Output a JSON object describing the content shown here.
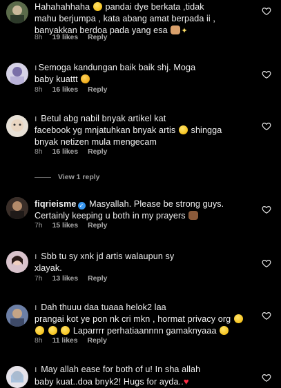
{
  "comments": [
    {
      "lines": [
        "Hahahahhaha",
        "pandai dye berkata ,tidak",
        "mahu berjumpa , kata abang amat berpada ii ,",
        "banyakkan berdoa pada yang esa"
      ],
      "time": "8h",
      "likes": "19 likes",
      "reply": "Reply"
    },
    {
      "lines": [
        "Semoga kandungan baik baik shj. Moga",
        "baby kuattt"
      ],
      "time": "8h",
      "likes": "16 likes",
      "reply": "Reply"
    },
    {
      "lines": [
        "Betul abg nabil bnyak artikel kat",
        "facebook yg mnjatuhkan bnyak artis",
        "shingga",
        "bnyak netizen mula mengecam"
      ],
      "time": "8h",
      "likes": "16 likes",
      "reply": "Reply"
    },
    {
      "username": "fiqrieisme",
      "lines": [
        "Masyallah. Please be strong guys.",
        "Certainly keeping u both in my prayers"
      ],
      "time": "7h",
      "likes": "15 likes",
      "reply": "Reply"
    },
    {
      "lines": [
        "Sbb tu sy xnk jd artis walaupun sy",
        "xlayak."
      ],
      "time": "7h",
      "likes": "13 likes",
      "reply": "Reply"
    },
    {
      "lines": [
        "Dah thuuu daa tuaaa helok2 laa",
        "prangai kot ye pon nk cri mkn , hormat privacy org",
        "Laparrrr perhatiaannnn gamaknyaaa"
      ],
      "time": "8h",
      "likes": "11 likes",
      "reply": "Reply"
    },
    {
      "lines": [
        "May allah ease for both of u! In sha allah",
        "baby kuat..doa bnyk2! Hugs for ayda.."
      ]
    }
  ],
  "view_replies": "View 1 reply",
  "colors": {
    "background": "#000000",
    "text": "#f2f2f2",
    "meta": "#9a9a9a",
    "verified": "#3897f0",
    "heart": "#ff2d45"
  },
  "icons": {
    "like": "heart-outline-icon",
    "verified": "verified-badge-icon"
  }
}
